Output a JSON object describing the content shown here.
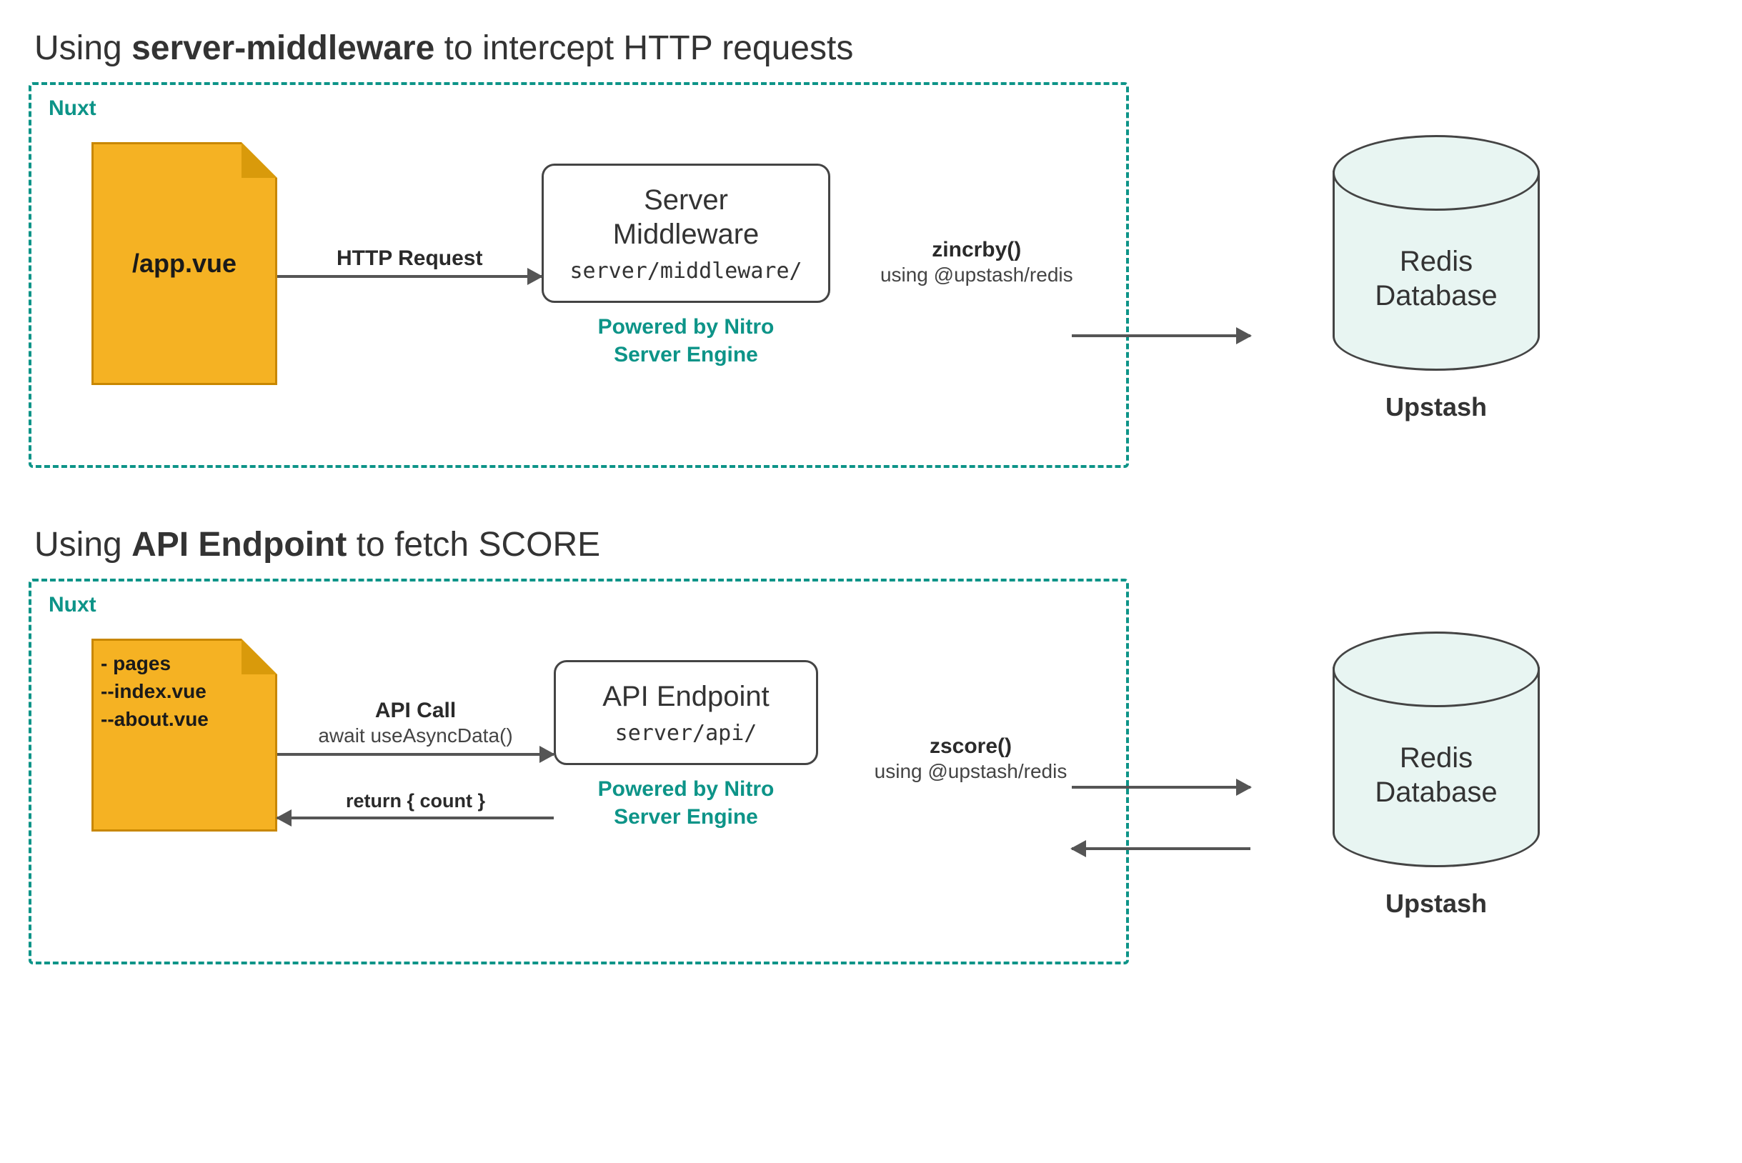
{
  "section1": {
    "title_prefix": "Using ",
    "title_bold": "server-middleware",
    "title_suffix": " to intercept HTTP requests",
    "nuxt_label": "Nuxt",
    "file_label": "/app.vue",
    "arrow1_label": "HTTP Request",
    "middle_title_l1": "Server",
    "middle_title_l2": "Middleware",
    "middle_path": "server/middleware/",
    "powered_l1": "Powered by Nitro",
    "powered_l2": "Server Engine",
    "arrow2_bold": "zincrby()",
    "arrow2_sub": "using @upstash/redis",
    "db_l1": "Redis",
    "db_l2": "Database",
    "db_name": "Upstash"
  },
  "section2": {
    "title_prefix": "Using ",
    "title_bold": "API Endpoint",
    "title_suffix": " to fetch SCORE",
    "nuxt_label": "Nuxt",
    "file_l1": "- pages",
    "file_l2": "--index.vue",
    "file_l3": "--about.vue",
    "arrow1_bold": "API Call",
    "arrow1_sub": "await useAsyncData()",
    "arrow_return": "return { count }",
    "middle_title": "API Endpoint",
    "middle_path": "server/api/",
    "powered_l1": "Powered by Nitro",
    "powered_l2": "Server Engine",
    "arrow2_bold": "zscore()",
    "arrow2_sub": "using @upstash/redis",
    "db_l1": "Redis",
    "db_l2": "Database",
    "db_name": "Upstash"
  }
}
